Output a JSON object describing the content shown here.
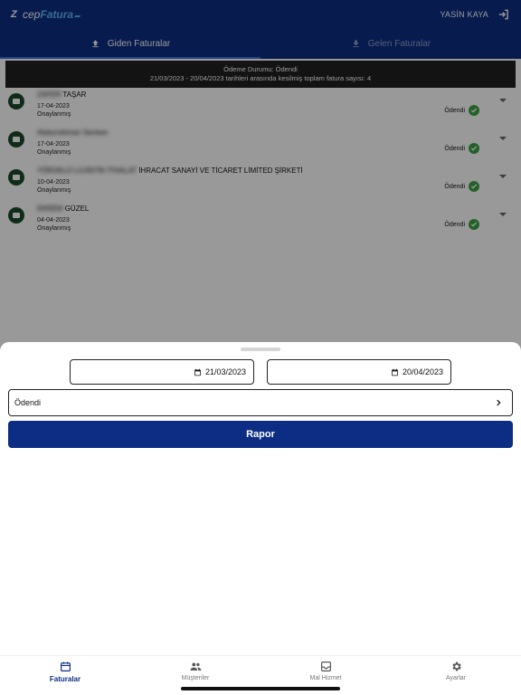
{
  "header": {
    "logo_mark": "Z",
    "logo_prefix": "cep",
    "logo_brand": "Fatura",
    "user_name": "YASİN KAYA",
    "logout_icon": "logout-icon"
  },
  "tabs": [
    {
      "label": "Giden Faturalar",
      "icon": "upload-icon",
      "active": true
    },
    {
      "label": "Gelen Faturalar",
      "icon": "download-icon",
      "active": false
    }
  ],
  "summary": {
    "line1": "Ödeme Durumu: Ödendi",
    "line2": "21/03/2023 - 20/04/2023 tarihleri arasında kesilmiş toplam fatura sayısı: 4"
  },
  "invoices": [
    {
      "name_hidden": "ZAFER",
      "name_visible": "TAŞAR",
      "date": "17-04-2023",
      "state": "Onaylanmış",
      "status": "Ödendi"
    },
    {
      "name_hidden": "Abdurrahman",
      "name_visible": "Sarıkan",
      "date": "17-04-2023",
      "state": "Onaylanmış",
      "status": "Ödendi"
    },
    {
      "name_hidden": "YÖRÜKLÜ LOJİSTİK İTHALAT",
      "name_visible": "İHRACAT SANAYİ VE TİCARET LİMİTED ŞİRKETİ",
      "date": "10-04-2023",
      "state": "Onaylanmış",
      "status": "Ödendi"
    },
    {
      "name_hidden": "EKREM",
      "name_visible": "GÜZEL",
      "date": "04-04-2023",
      "state": "Onaylanmış",
      "status": "Ödendi"
    }
  ],
  "filter": {
    "start_date": "21/03/2023",
    "end_date": "20/04/2023",
    "payment_status": "Ödendi",
    "report_label": "Rapor"
  },
  "nav": [
    {
      "label": "Faturalar",
      "icon": "calendar-icon",
      "active": true
    },
    {
      "label": "Müşteriler",
      "icon": "people-icon",
      "active": false
    },
    {
      "label": "Mal Hizmet",
      "icon": "inbox-icon",
      "active": false
    },
    {
      "label": "Ayarlar",
      "icon": "gear-icon",
      "active": false
    }
  ],
  "colors": {
    "primary": "#0c2d83",
    "accent": "#5fb4f0",
    "success": "#3aa345"
  }
}
